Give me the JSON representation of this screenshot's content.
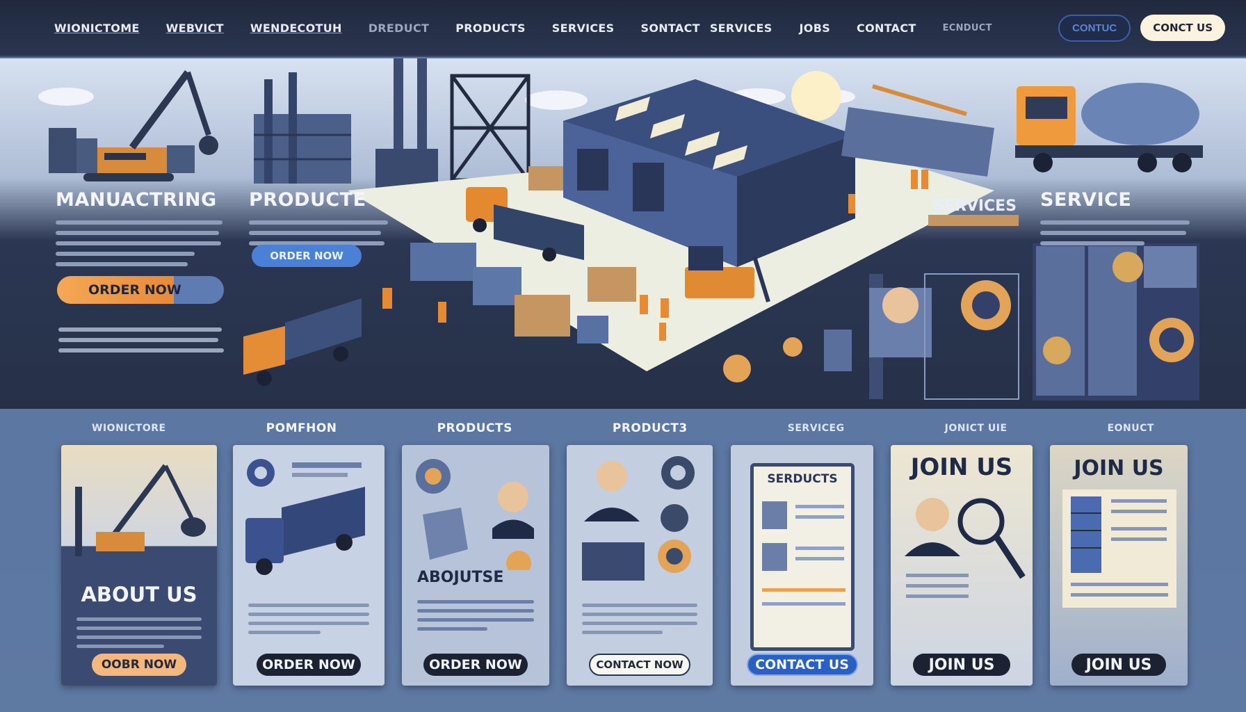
{
  "nav": {
    "items": [
      "WIONICTOME",
      "WEBVICT",
      "WENDECOTUH",
      "DREDUCT",
      "PRODUCTS",
      "SERVICES",
      "SONTACT",
      "SERVICES",
      "JOBS",
      "CONTACT",
      "ECNDUCT"
    ],
    "pill": "CONTUC",
    "cta": "CONCT US"
  },
  "hero": {
    "left_title": "MANUACTRING",
    "left_button": "ORDER NOW",
    "mid_title": "PRODUCTE",
    "mid_button": "ORDER NOW",
    "right_subtitle": "SERVICES",
    "right_title": "SERVICE"
  },
  "tabs": [
    "WIONICTORE",
    "POMFHON",
    "PRODUCTS",
    "PRODUCT3",
    "SERVICEG",
    "JONICT UIE",
    "EONUCT"
  ],
  "cards": [
    {
      "title": "ABOUT US",
      "button": "OOBR NOW"
    },
    {
      "title": "",
      "button": "ORDER NOW"
    },
    {
      "title": "ABOJUTSE",
      "button": "ORDER NOW"
    },
    {
      "title": "",
      "button": "CONTACT NOW"
    },
    {
      "title": "SERDUCTS",
      "button": "CONTACT US"
    },
    {
      "title": "JOIN US",
      "button": "JOIN US"
    },
    {
      "title": "JOIN US",
      "button": "JOIN US"
    }
  ],
  "colors": {
    "nav_bg": "#20293d",
    "accent_orange": "#f5a855",
    "accent_blue": "#4a80d6",
    "card_bg": "#c7d2e4"
  }
}
